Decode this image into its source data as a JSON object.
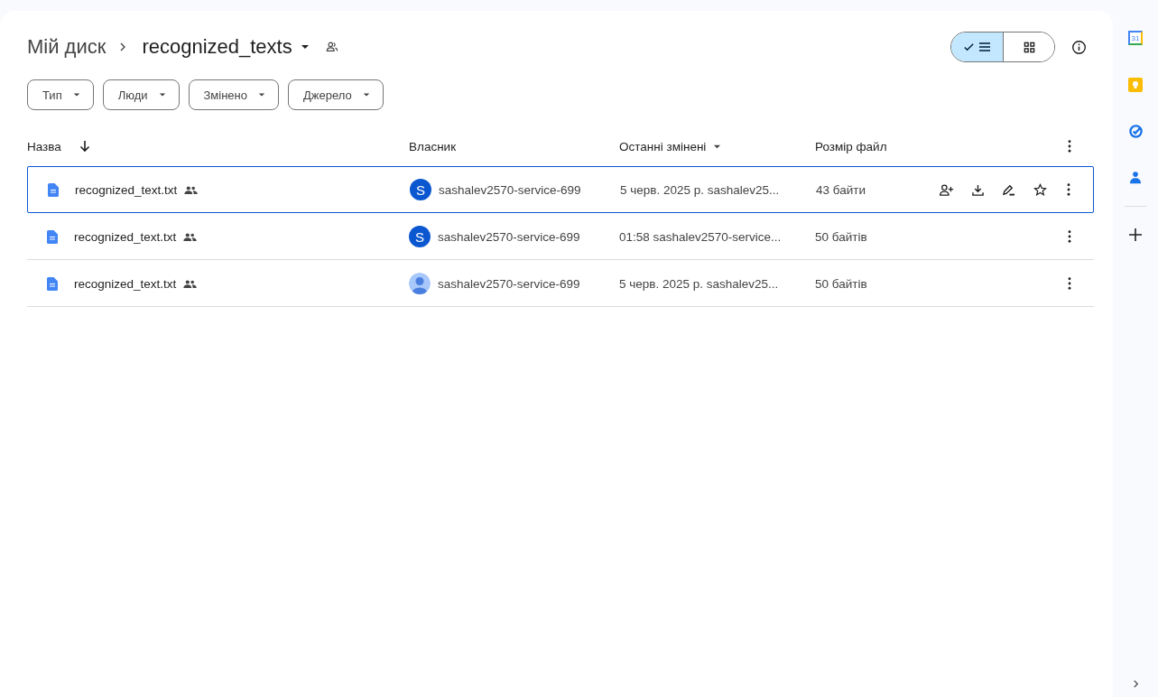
{
  "breadcrumb": {
    "root": "Мій диск",
    "current": "recognized_texts"
  },
  "view_toggle": [
    {
      "kind": "list",
      "selected": true
    },
    {
      "kind": "grid",
      "selected": false
    }
  ],
  "filters": [
    "Тип",
    "Люди",
    "Змінено",
    "Джерело"
  ],
  "columns": [
    {
      "label": "Назва",
      "kind": "name"
    },
    {
      "label": "Власник",
      "kind": "owner"
    },
    {
      "label": "Останні змінені",
      "kind": "modified"
    },
    {
      "label": "Розмір файл",
      "kind": "size"
    }
  ],
  "rows": [
    {
      "name": "recognized_text.txt",
      "shared": true,
      "avatar": {
        "kind": "letter",
        "letter": "S"
      },
      "owner": "sashalev2570-service-699",
      "modified": "5 черв. 2025 р. sashalev25...",
      "size": "43 байти",
      "selected": true
    },
    {
      "name": "recognized_text.txt",
      "shared": true,
      "avatar": {
        "kind": "letter",
        "letter": "S"
      },
      "owner": "sashalev2570-service-699",
      "modified": "01:58 sashalev2570-service...",
      "size": "50 байтів",
      "selected": false
    },
    {
      "name": "recognized_text.txt",
      "shared": true,
      "avatar": {
        "kind": "person"
      },
      "owner": "sashalev2570-service-699",
      "modified": "5 черв. 2025 р. sashalev25...",
      "size": "50 байтів",
      "selected": false
    }
  ],
  "side_apps": [
    {
      "kind": "calendar",
      "label": "31"
    },
    {
      "kind": "keep"
    },
    {
      "kind": "tasks"
    },
    {
      "kind": "contacts"
    }
  ]
}
